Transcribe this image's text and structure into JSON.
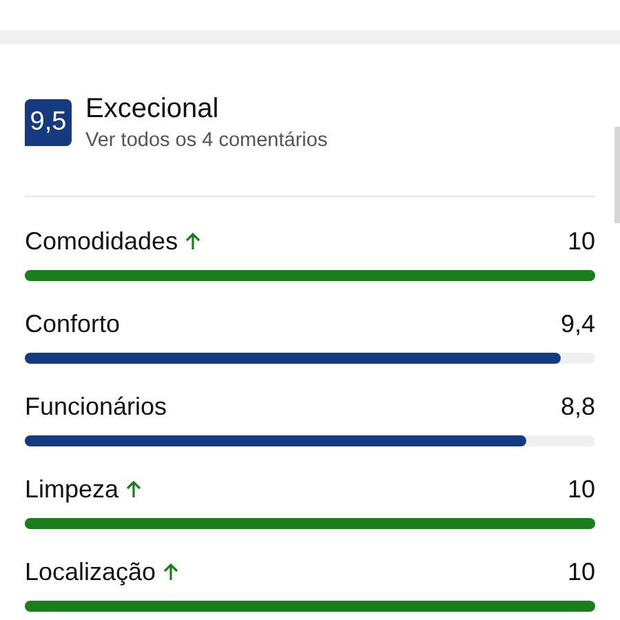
{
  "score": {
    "value": "9,5",
    "label": "Excecional",
    "reviews_link": "Ver todos os 4 comentários"
  },
  "categories": [
    {
      "name": "Comodidades",
      "trending_up": true,
      "score": "10",
      "level": 1,
      "color": "#1a7f1a"
    },
    {
      "name": "Conforto",
      "trending_up": false,
      "score": "9,4",
      "level": 0.94,
      "color": "#153a80"
    },
    {
      "name": "Funcionários",
      "trending_up": false,
      "score": "8,8",
      "level": 0.88,
      "color": "#153a80"
    },
    {
      "name": "Limpeza",
      "trending_up": true,
      "score": "10",
      "level": 1,
      "color": "#1a7f1a"
    },
    {
      "name": "Localização",
      "trending_up": true,
      "score": "10",
      "level": 1,
      "color": "#1a7f1a"
    }
  ]
}
